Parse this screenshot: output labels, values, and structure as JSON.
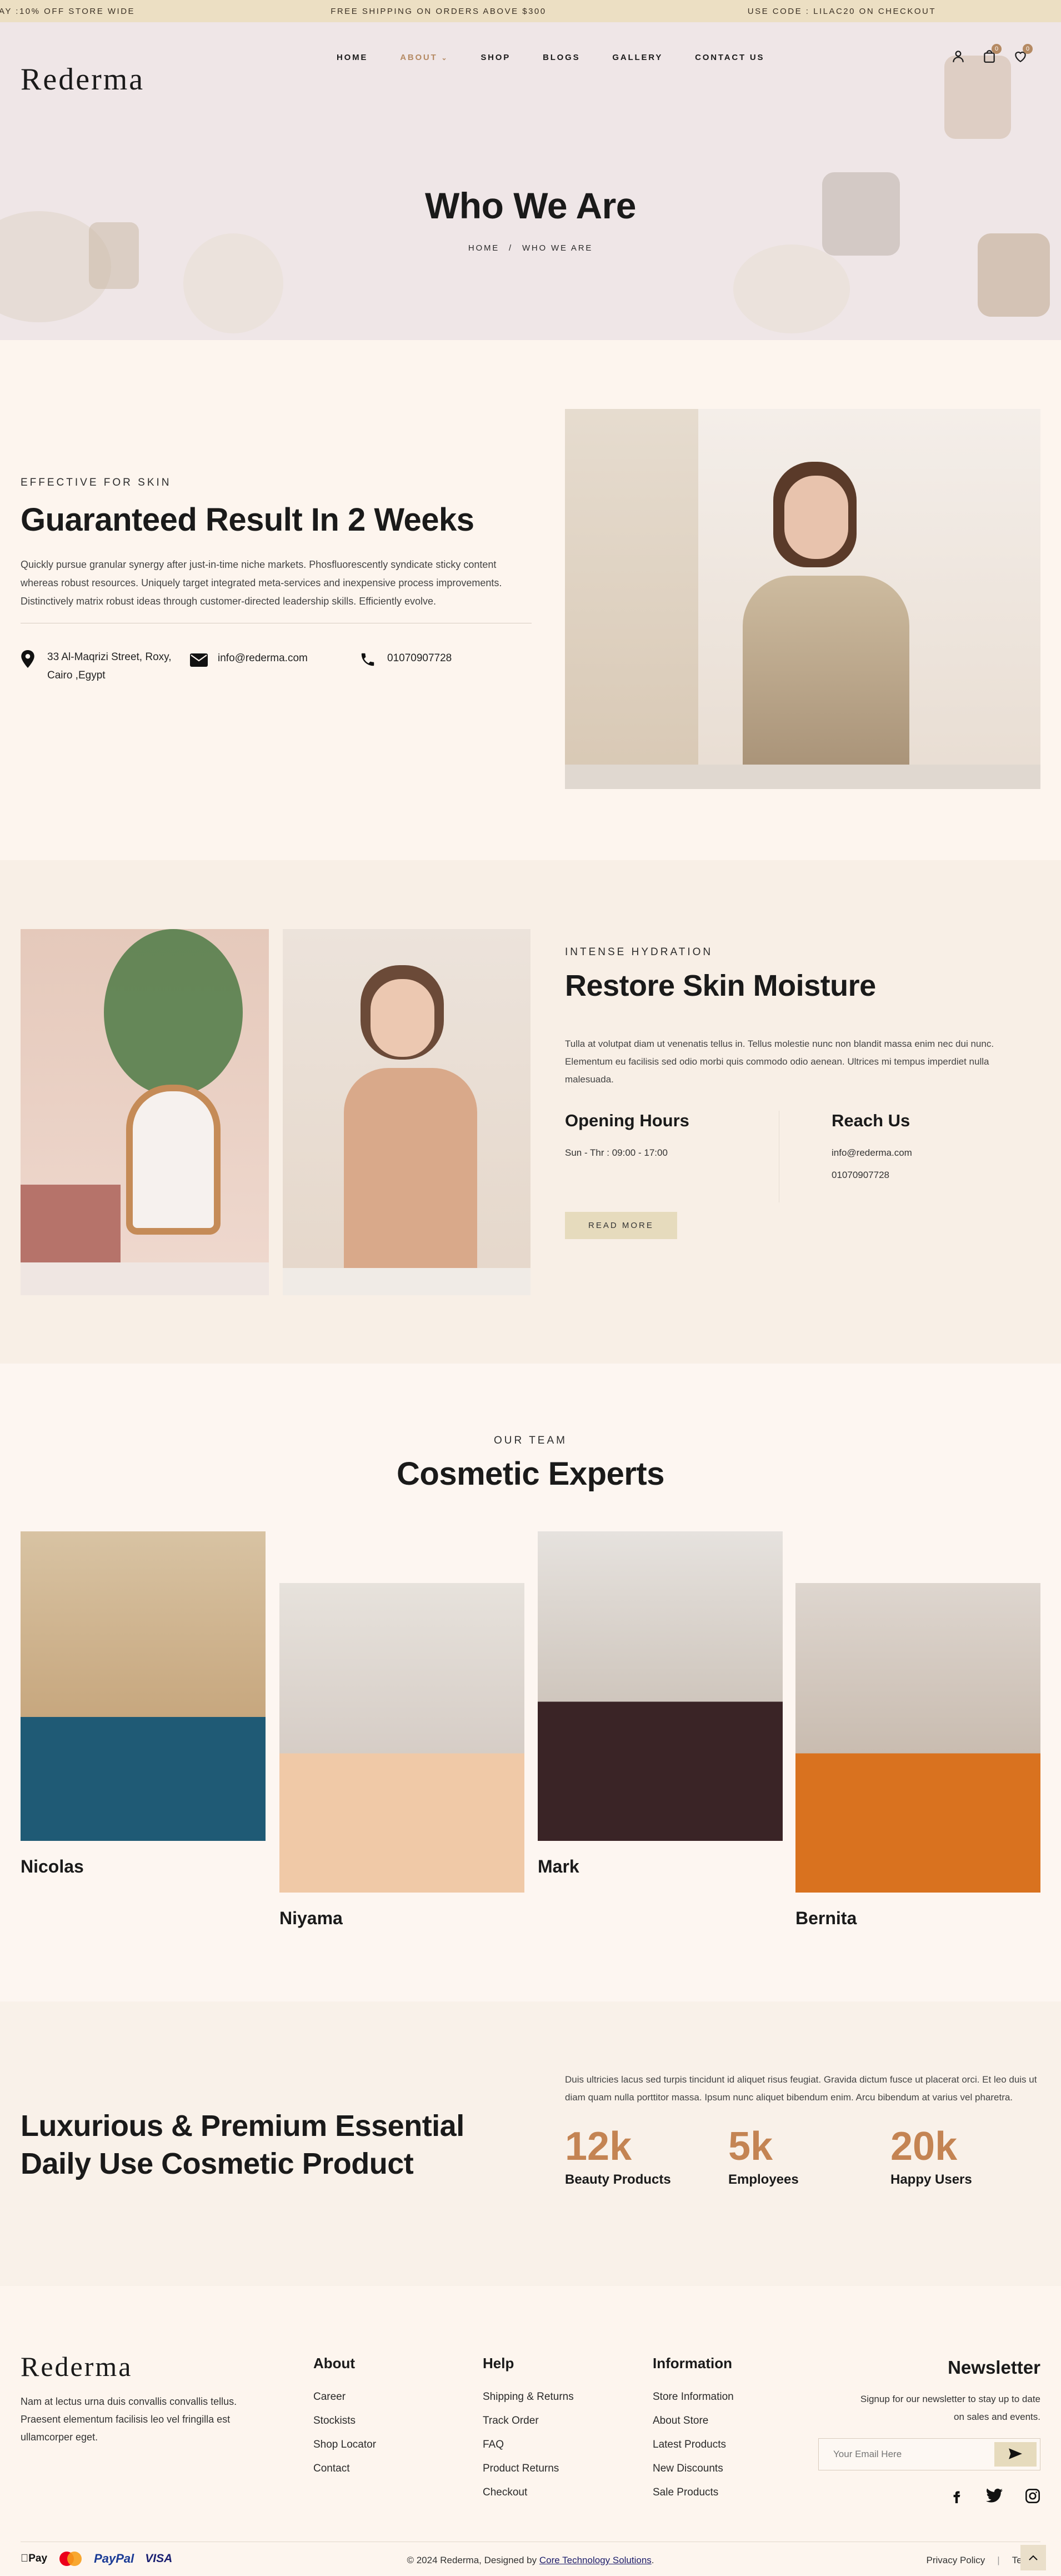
{
  "topbar": {
    "left": "AY :10% OFF STORE WIDE",
    "center": "FREE SHIPPING ON ORDERS ABOVE $300",
    "right": "USE CODE : LILAC20 ON CHECKOUT"
  },
  "brand": {
    "logo": "Rederma"
  },
  "nav": {
    "items": [
      "HOME",
      "ABOUT",
      "SHOP",
      "BLOGS",
      "GALLERY",
      "CONTACT US"
    ],
    "about_caret": "⌄",
    "cart_count": "0",
    "wish_count": "0"
  },
  "hero": {
    "title": "Who We Are",
    "breadcrumb_home": "HOME",
    "breadcrumb_sep": "/",
    "breadcrumb_current": "WHO WE ARE"
  },
  "about": {
    "kicker": "EFFECTIVE FOR SKIN",
    "title": "Guaranteed Result In 2 Weeks",
    "text": "Quickly pursue granular synergy after just-in-time niche markets. Phosfluorescently syndicate sticky content whereas robust resources. Uniquely target integrated meta-services and inexpensive process improvements. Distinctively matrix robust ideas through customer-directed leadership skills. Efficiently evolve.",
    "address_1": "33 Al-Maqrizi Street, Roxy,",
    "address_2": "Cairo ,Egypt",
    "email": "info@rederma.com",
    "phone": "01070907728"
  },
  "hydration": {
    "kicker": "INTENSE HYDRATION",
    "title": "Restore Skin Moisture",
    "text": "Tulla at volutpat diam ut venenatis tellus in. Tellus molestie nunc non blandit massa enim nec dui nunc. Elementum eu facilisis sed odio morbi quis commodo odio aenean. Ultrices mi tempus imperdiet nulla malesuada.",
    "hours_title": "Opening Hours",
    "hours": "Sun - Thr : 09:00 - 17:00",
    "reach_title": "Reach Us",
    "reach_email": "info@rederma.com",
    "reach_phone": "01070907728",
    "button": "READ MORE"
  },
  "team": {
    "kicker": "OUR TEAM",
    "title": "Cosmetic Experts",
    "members": [
      "Nicolas",
      "Niyama",
      "Mark",
      "Bernita"
    ]
  },
  "stats": {
    "title_1": "Luxurious & Premium Essential",
    "title_2": "Daily Use Cosmetic Product",
    "text": "Duis ultricies lacus sed turpis tincidunt id aliquet risus feugiat. Gravida dictum fusce ut placerat orci. Et leo duis ut diam quam nulla porttitor massa. Ipsum nunc aliquet bibendum enim. Arcu bibendum at varius vel pharetra.",
    "items": [
      {
        "num": "12k",
        "label": "Beauty Products"
      },
      {
        "num": "5k",
        "label": "Employees"
      },
      {
        "num": "20k",
        "label": "Happy Users"
      }
    ]
  },
  "footer": {
    "logo": "Rederma",
    "about_text": "Nam at lectus urna duis convallis convallis tellus. Praesent elementum facilisis leo vel fringilla est ullamcorper eget.",
    "cols": [
      {
        "title": "About",
        "links": [
          "Career",
          "Stockists",
          "Shop Locator",
          "Contact"
        ]
      },
      {
        "title": "Help",
        "links": [
          "Shipping & Returns",
          "Track Order",
          "FAQ",
          "Product Returns",
          "Checkout"
        ]
      },
      {
        "title": "Information",
        "links": [
          "Store Information",
          "About Store",
          "Latest Products",
          "New Discounts",
          "Sale Products"
        ]
      }
    ],
    "newsletter_title": "Newsletter",
    "newsletter_text_1": "Signup for our newsletter to stay up to date",
    "newsletter_text_2": "on sales and events.",
    "email_placeholder": "Your Email Here",
    "copyright_prefix": "© 2024 Rederma, Designed by ",
    "copyright_link": "Core Technology Solutions",
    "copyright_suffix": ".",
    "privacy": "Privacy Policy",
    "terms": "Terms",
    "payments": [
      "Pay",
      "PayPal",
      "VISA"
    ]
  },
  "colors": {
    "accent": "#b58a63",
    "stat": "#c48453",
    "topbar": "#ecdfc3",
    "hero": "#efe6e7",
    "cream": "#fdf5ee"
  },
  "icons": [
    "user-icon",
    "bag-icon",
    "heart-icon",
    "location-icon",
    "mail-icon",
    "phone-icon",
    "send-icon",
    "facebook-icon",
    "twitter-icon",
    "instagram-icon",
    "arrow-up-icon"
  ]
}
